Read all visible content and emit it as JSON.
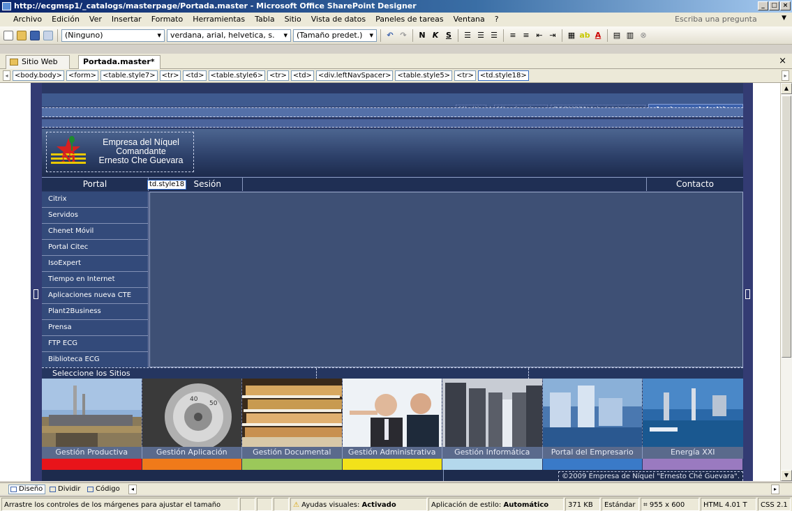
{
  "window": {
    "title": "http://ecgmsp1/_catalogs/masterpage/Portada.master - Microsoft Office SharePoint Designer",
    "btn_min": "_",
    "btn_max": "□",
    "btn_close": "×"
  },
  "menu": {
    "items": [
      "Archivo",
      "Edición",
      "Ver",
      "Insertar",
      "Formato",
      "Herramientas",
      "Tabla",
      "Sitio",
      "Vista de datos",
      "Paneles de tareas",
      "Ventana",
      "?"
    ],
    "ask_placeholder": "Escriba una pregunta"
  },
  "toolbar": {
    "style_select": "(Ninguno)",
    "font_select": "verdana, arial, helvetica, s.",
    "size_select": "(Tamaño predet.)",
    "bold": "N",
    "italic": "K",
    "underline": "S"
  },
  "tabs": {
    "items": [
      {
        "label": "Sitio Web",
        "active": false
      },
      {
        "label": "Portada.master*",
        "active": true
      }
    ],
    "close_glyph": "×"
  },
  "breadcrumb": [
    "<body.body>",
    "<form>",
    "<table.style7>",
    "<tr>",
    "<td>",
    "<table.style6>",
    "<tr>",
    "<td>",
    "<div.leftNavSpacer>",
    "<table.style5>",
    "<tr>",
    "<td.style18>"
  ],
  "page": {
    "topnav": {
      "mi_sitio": "Mi sitio",
      "sep": "|",
      "mis_vinculos": "Mis vínculos ▾",
      "user": "ECGMSP1\\Administrator ▾",
      "acciones": "Acciones del sitio ▾"
    },
    "logo_text": [
      "Empresa del Níquel",
      "Comandante",
      "Ernesto Che Guevara"
    ],
    "nav": {
      "portal": "Portal",
      "tag": "td.style18",
      "sesion": "Sesión",
      "contacto": "Contacto"
    },
    "leftnav": [
      "Citrix",
      "Servidos",
      "Chenet Móvil",
      "Portal Citec",
      "IsoExpert",
      "Tiempo en Internet",
      "Aplicaciones nueva CTE",
      "Plant2Business",
      "Prensa",
      "FTP ECG",
      "Biblioteca ECG"
    ],
    "select_label": "Seleccione los Sitios",
    "sites": [
      {
        "label": "Gestión Productiva",
        "color": "#e8141a"
      },
      {
        "label": "Gestión Aplicación",
        "color": "#f07a1a"
      },
      {
        "label": "Gestión Documental",
        "color": "#9bc85a"
      },
      {
        "label": "Gestión Administrativa",
        "color": "#f2e21a"
      },
      {
        "label": "Gestión Informática",
        "color": "#b4d8ec"
      },
      {
        "label": "Portal del Empresario",
        "color": "#3a7ac8"
      },
      {
        "label": "Energía XXI",
        "color": "#9a7ac0"
      }
    ],
    "copyright": "©2009 Empresa de Níquel \"Ernesto Ché Guevara\"."
  },
  "views": {
    "diseno": "Diseño",
    "dividir": "Dividir",
    "codigo": "Código"
  },
  "status": {
    "hint": "Arrastre los controles de los márgenes para ajustar el tamaño",
    "ayudas_label": "Ayudas visuales:",
    "ayudas_value": "Activado",
    "estilo_label": "Aplicación de estilo:",
    "estilo_value": "Automático",
    "size": "371 KB",
    "mode": "Estándar",
    "dimensions": "955 x 600",
    "doctype": "HTML 4.01 T",
    "css": "CSS 2.1"
  }
}
